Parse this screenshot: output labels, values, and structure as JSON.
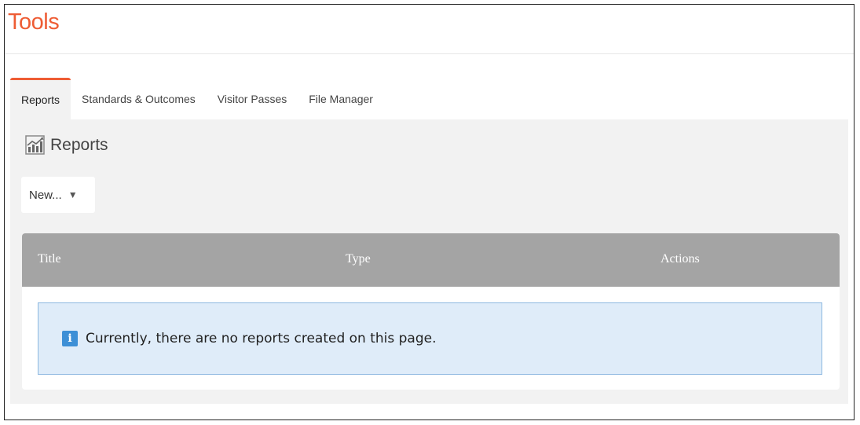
{
  "header": {
    "title": "Tools"
  },
  "tabs": [
    {
      "label": "Reports",
      "active": true
    },
    {
      "label": "Standards & Outcomes",
      "active": false
    },
    {
      "label": "Visitor Passes",
      "active": false
    },
    {
      "label": "File Manager",
      "active": false
    }
  ],
  "section": {
    "icon": "chart-icon",
    "heading": "Reports"
  },
  "new_dropdown": {
    "label": "New...",
    "icon": "caret-down-icon"
  },
  "table": {
    "columns": [
      "Title",
      "Type",
      "Actions"
    ],
    "empty_message": "Currently, there are no reports created on this page.",
    "empty_icon": "info-icon"
  },
  "colors": {
    "accent": "#ee5c34",
    "header_bg": "#a4a4a4",
    "alert_bg": "#dfecf9",
    "info": "#3d8fd6"
  }
}
